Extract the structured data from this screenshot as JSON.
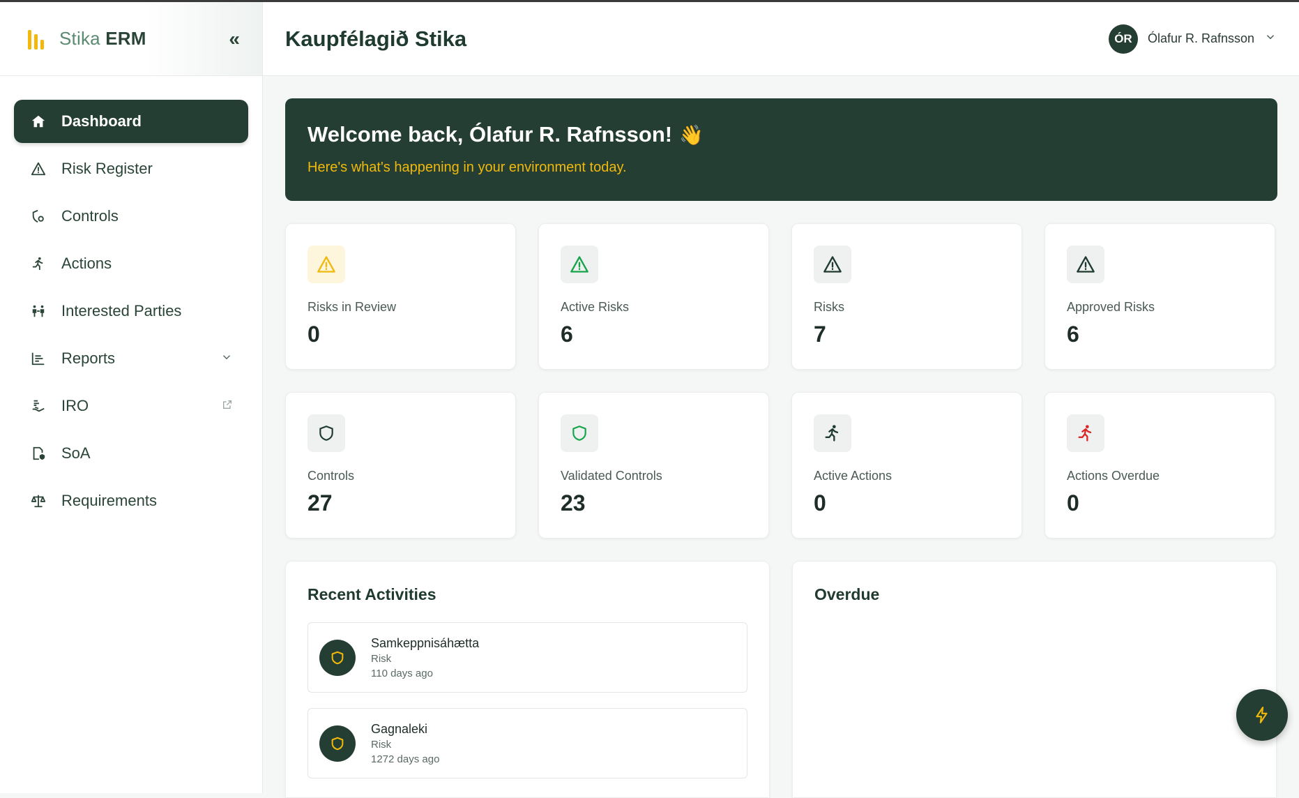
{
  "brand": {
    "name_light": "Stika",
    "name_bold": "ERM",
    "collapse_icon": "«"
  },
  "header": {
    "org_title": "Kaupfélagið Stika",
    "user_initials": "ÓR",
    "user_name": "Ólafur R. Rafnsson",
    "chevron": "⌄"
  },
  "sidebar": {
    "items": [
      {
        "label": "Dashboard",
        "icon": "home-icon",
        "active": true
      },
      {
        "label": "Risk Register",
        "icon": "warning-icon"
      },
      {
        "label": "Controls",
        "icon": "shield-gear-icon"
      },
      {
        "label": "Actions",
        "icon": "running-person-icon"
      },
      {
        "label": "Interested Parties",
        "icon": "people-icon"
      },
      {
        "label": "Reports",
        "icon": "chart-icon",
        "right": "chevron-down-icon"
      },
      {
        "label": "IRO",
        "icon": "hand-coins-icon",
        "right": "external-link-icon"
      },
      {
        "label": "SoA",
        "icon": "document-shield-icon"
      },
      {
        "label": "Requirements",
        "icon": "scales-icon"
      }
    ]
  },
  "welcome": {
    "title": "Welcome back, Ólafur R. Rafnsson!",
    "emoji": "👋",
    "subtitle": "Here's what's happening in your environment today."
  },
  "stats": [
    {
      "label": "Risks in Review",
      "value": "0",
      "icon": "warning-icon",
      "color": "#f0b90b"
    },
    {
      "label": "Active Risks",
      "value": "6",
      "icon": "warning-icon",
      "color": "#16a34a"
    },
    {
      "label": "Risks",
      "value": "7",
      "icon": "warning-icon",
      "color": "#1f3a2e"
    },
    {
      "label": "Approved Risks",
      "value": "6",
      "icon": "warning-icon",
      "color": "#1f3a2e"
    },
    {
      "label": "Controls",
      "value": "27",
      "icon": "shield-icon",
      "color": "#1f3a2e"
    },
    {
      "label": "Validated Controls",
      "value": "23",
      "icon": "shield-icon",
      "color": "#16a34a"
    },
    {
      "label": "Active Actions",
      "value": "0",
      "icon": "running-person-icon",
      "color": "#1f3a2e"
    },
    {
      "label": "Actions Overdue",
      "value": "0",
      "icon": "running-person-icon",
      "color": "#dc2626"
    }
  ],
  "recent": {
    "title": "Recent Activities",
    "items": [
      {
        "title": "Samkeppnisáhætta",
        "type": "Risk",
        "time": "110 days ago"
      },
      {
        "title": "Gagnaleki",
        "type": "Risk",
        "time": "1272 days ago"
      }
    ]
  },
  "overdue": {
    "title": "Overdue"
  },
  "colors": {
    "primary": "#243e33",
    "accent": "#f0b90b"
  }
}
